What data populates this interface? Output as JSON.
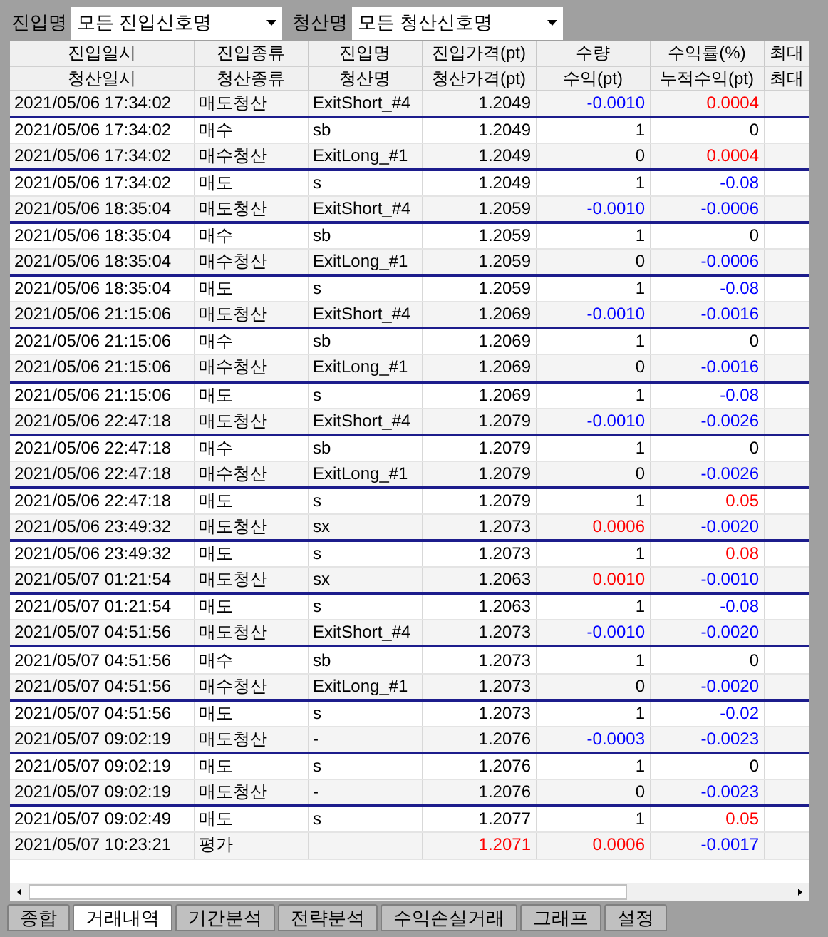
{
  "filters": [
    {
      "label": "진입명",
      "value": "모든 진입신호명"
    },
    {
      "label": "청산명",
      "value": "모든 청산신호명"
    }
  ],
  "table": {
    "header_rows": [
      [
        "진입일시",
        "진입종류",
        "진입명",
        "진입가격(pt)",
        "수량",
        "수익률(%)",
        "최대"
      ],
      [
        "청산일시",
        "청산종류",
        "청산명",
        "청산가격(pt)",
        "수익(pt)",
        "누적수익(pt)",
        "최대"
      ]
    ],
    "rows": [
      {
        "kind": "exit",
        "time": "2021/05/06 17:34:02",
        "type": "매도청산",
        "name": "ExitShort_#4",
        "price": {
          "text": "1.2049"
        },
        "qty": {
          "text": "-0.0010",
          "color": "#0000ff"
        },
        "rate": {
          "text": "0.0004",
          "color": "#ff0000"
        }
      },
      {
        "kind": "entry",
        "time": "2021/05/06 17:34:02",
        "type": "매수",
        "name": "sb",
        "price": {
          "text": "1.2049"
        },
        "qty": {
          "text": "1"
        },
        "rate": {
          "text": "0"
        }
      },
      {
        "kind": "exit",
        "time": "2021/05/06 17:34:02",
        "type": "매수청산",
        "name": "ExitLong_#1",
        "price": {
          "text": "1.2049"
        },
        "qty": {
          "text": "0"
        },
        "rate": {
          "text": "0.0004",
          "color": "#ff0000"
        }
      },
      {
        "kind": "entry",
        "time": "2021/05/06 17:34:02",
        "type": "매도",
        "name": "s",
        "price": {
          "text": "1.2049"
        },
        "qty": {
          "text": "1"
        },
        "rate": {
          "text": "-0.08",
          "color": "#0000ff"
        }
      },
      {
        "kind": "exit",
        "time": "2021/05/06 18:35:04",
        "type": "매도청산",
        "name": "ExitShort_#4",
        "price": {
          "text": "1.2059"
        },
        "qty": {
          "text": "-0.0010",
          "color": "#0000ff"
        },
        "rate": {
          "text": "-0.0006",
          "color": "#0000ff"
        }
      },
      {
        "kind": "entry",
        "time": "2021/05/06 18:35:04",
        "type": "매수",
        "name": "sb",
        "price": {
          "text": "1.2059"
        },
        "qty": {
          "text": "1"
        },
        "rate": {
          "text": "0"
        }
      },
      {
        "kind": "exit",
        "time": "2021/05/06 18:35:04",
        "type": "매수청산",
        "name": "ExitLong_#1",
        "price": {
          "text": "1.2059"
        },
        "qty": {
          "text": "0"
        },
        "rate": {
          "text": "-0.0006",
          "color": "#0000ff"
        }
      },
      {
        "kind": "entry",
        "time": "2021/05/06 18:35:04",
        "type": "매도",
        "name": "s",
        "price": {
          "text": "1.2059"
        },
        "qty": {
          "text": "1"
        },
        "rate": {
          "text": "-0.08",
          "color": "#0000ff"
        }
      },
      {
        "kind": "exit",
        "time": "2021/05/06 21:15:06",
        "type": "매도청산",
        "name": "ExitShort_#4",
        "price": {
          "text": "1.2069"
        },
        "qty": {
          "text": "-0.0010",
          "color": "#0000ff"
        },
        "rate": {
          "text": "-0.0016",
          "color": "#0000ff"
        }
      },
      {
        "kind": "entry",
        "time": "2021/05/06 21:15:06",
        "type": "매수",
        "name": "sb",
        "price": {
          "text": "1.2069"
        },
        "qty": {
          "text": "1"
        },
        "rate": {
          "text": "0"
        }
      },
      {
        "kind": "exit",
        "time": "2021/05/06 21:15:06",
        "type": "매수청산",
        "name": "ExitLong_#1",
        "price": {
          "text": "1.2069"
        },
        "qty": {
          "text": "0"
        },
        "rate": {
          "text": "-0.0016",
          "color": "#0000ff"
        }
      },
      {
        "kind": "entry",
        "time": "2021/05/06 21:15:06",
        "type": "매도",
        "name": "s",
        "price": {
          "text": "1.2069"
        },
        "qty": {
          "text": "1"
        },
        "rate": {
          "text": "-0.08",
          "color": "#0000ff"
        }
      },
      {
        "kind": "exit",
        "time": "2021/05/06 22:47:18",
        "type": "매도청산",
        "name": "ExitShort_#4",
        "price": {
          "text": "1.2079"
        },
        "qty": {
          "text": "-0.0010",
          "color": "#0000ff"
        },
        "rate": {
          "text": "-0.0026",
          "color": "#0000ff"
        }
      },
      {
        "kind": "entry",
        "time": "2021/05/06 22:47:18",
        "type": "매수",
        "name": "sb",
        "price": {
          "text": "1.2079"
        },
        "qty": {
          "text": "1"
        },
        "rate": {
          "text": "0"
        }
      },
      {
        "kind": "exit",
        "time": "2021/05/06 22:47:18",
        "type": "매수청산",
        "name": "ExitLong_#1",
        "price": {
          "text": "1.2079"
        },
        "qty": {
          "text": "0"
        },
        "rate": {
          "text": "-0.0026",
          "color": "#0000ff"
        }
      },
      {
        "kind": "entry",
        "time": "2021/05/06 22:47:18",
        "type": "매도",
        "name": "s",
        "price": {
          "text": "1.2079"
        },
        "qty": {
          "text": "1"
        },
        "rate": {
          "text": "0.05",
          "color": "#ff0000"
        }
      },
      {
        "kind": "exit",
        "time": "2021/05/06 23:49:32",
        "type": "매도청산",
        "name": "sx",
        "price": {
          "text": "1.2073"
        },
        "qty": {
          "text": "0.0006",
          "color": "#ff0000"
        },
        "rate": {
          "text": "-0.0020",
          "color": "#0000ff"
        }
      },
      {
        "kind": "entry",
        "time": "2021/05/06 23:49:32",
        "type": "매도",
        "name": "s",
        "price": {
          "text": "1.2073"
        },
        "qty": {
          "text": "1"
        },
        "rate": {
          "text": "0.08",
          "color": "#ff0000"
        }
      },
      {
        "kind": "exit",
        "time": "2021/05/07 01:21:54",
        "type": "매도청산",
        "name": "sx",
        "price": {
          "text": "1.2063"
        },
        "qty": {
          "text": "0.0010",
          "color": "#ff0000"
        },
        "rate": {
          "text": "-0.0010",
          "color": "#0000ff"
        }
      },
      {
        "kind": "entry",
        "time": "2021/05/07 01:21:54",
        "type": "매도",
        "name": "s",
        "price": {
          "text": "1.2063"
        },
        "qty": {
          "text": "1"
        },
        "rate": {
          "text": "-0.08",
          "color": "#0000ff"
        }
      },
      {
        "kind": "exit",
        "time": "2021/05/07 04:51:56",
        "type": "매도청산",
        "name": "ExitShort_#4",
        "price": {
          "text": "1.2073"
        },
        "qty": {
          "text": "-0.0010",
          "color": "#0000ff"
        },
        "rate": {
          "text": "-0.0020",
          "color": "#0000ff"
        }
      },
      {
        "kind": "entry",
        "time": "2021/05/07 04:51:56",
        "type": "매수",
        "name": "sb",
        "price": {
          "text": "1.2073"
        },
        "qty": {
          "text": "1"
        },
        "rate": {
          "text": "0"
        }
      },
      {
        "kind": "exit",
        "time": "2021/05/07 04:51:56",
        "type": "매수청산",
        "name": "ExitLong_#1",
        "price": {
          "text": "1.2073"
        },
        "qty": {
          "text": "0"
        },
        "rate": {
          "text": "-0.0020",
          "color": "#0000ff"
        }
      },
      {
        "kind": "entry",
        "time": "2021/05/07 04:51:56",
        "type": "매도",
        "name": "s",
        "price": {
          "text": "1.2073"
        },
        "qty": {
          "text": "1"
        },
        "rate": {
          "text": "-0.02",
          "color": "#0000ff"
        }
      },
      {
        "kind": "exit",
        "time": "2021/05/07 09:02:19",
        "type": "매도청산",
        "name": "-",
        "price": {
          "text": "1.2076"
        },
        "qty": {
          "text": "-0.0003",
          "color": "#0000ff"
        },
        "rate": {
          "text": "-0.0023",
          "color": "#0000ff"
        }
      },
      {
        "kind": "entry",
        "time": "2021/05/07 09:02:19",
        "type": "매도",
        "name": "s",
        "price": {
          "text": "1.2076"
        },
        "qty": {
          "text": "1"
        },
        "rate": {
          "text": "0"
        }
      },
      {
        "kind": "exit",
        "time": "2021/05/07 09:02:19",
        "type": "매도청산",
        "name": "-",
        "price": {
          "text": "1.2076"
        },
        "qty": {
          "text": "0"
        },
        "rate": {
          "text": "-0.0023",
          "color": "#0000ff"
        }
      },
      {
        "kind": "entry",
        "time": "2021/05/07 09:02:49",
        "type": "매도",
        "name": "s",
        "price": {
          "text": "1.2077"
        },
        "qty": {
          "text": "1"
        },
        "rate": {
          "text": "0.05",
          "color": "#ff0000"
        }
      },
      {
        "kind": "exit",
        "time": "2021/05/07 10:23:21",
        "type": "평가",
        "price": {
          "text": "1.2071",
          "color": "#ff0000"
        },
        "qty": {
          "text": "0.0006",
          "color": "#ff0000"
        },
        "rate": {
          "text": "-0.0017",
          "color": "#0000ff"
        }
      }
    ]
  },
  "tabs": [
    {
      "label": "종합",
      "selected": false
    },
    {
      "label": "거래내역",
      "selected": true
    },
    {
      "label": "기간분석",
      "selected": false
    },
    {
      "label": "전략분석",
      "selected": false
    },
    {
      "label": "수익손실거래",
      "selected": false
    },
    {
      "label": "그래프",
      "selected": false
    },
    {
      "label": "설정",
      "selected": false
    }
  ]
}
